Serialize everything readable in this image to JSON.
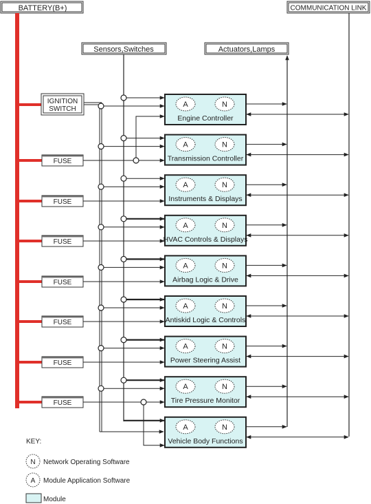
{
  "colors": {
    "battery_bus": "#e0302a",
    "module_fill": "#d8f3f3",
    "line": "#222222"
  },
  "headers": {
    "battery": "BATTERY(B+)",
    "communication_link": "COMMUNICATION LINK",
    "sensors_switches": "Sensors,Switches",
    "actuators_lamps": "Actuators,Lamps"
  },
  "power": {
    "ignition_switch_line1": "IGNITION",
    "ignition_switch_line2": "SWITCH",
    "fuse_label": "FUSE",
    "fuses": [
      "FUSE",
      "FUSE",
      "FUSE",
      "FUSE",
      "FUSE",
      "FUSE",
      "FUSE"
    ]
  },
  "module_badges": {
    "application": "A",
    "network": "N"
  },
  "modules": [
    {
      "name": "Engine Controller"
    },
    {
      "name": "Transmission Controller"
    },
    {
      "name": "Instruments & Displays"
    },
    {
      "name": "HVAC Controls & Displays"
    },
    {
      "name": "Airbag Logic & Drive"
    },
    {
      "name": "Antiskid Logic & Controls"
    },
    {
      "name": "Power Steering Assist"
    },
    {
      "name": "Tire Pressure Monitor"
    },
    {
      "name": "Vehicle Body Functions"
    }
  ],
  "key": {
    "title": "KEY:",
    "items": [
      {
        "symbol": "N",
        "label": "Network Operating Software"
      },
      {
        "symbol": "A",
        "label": "Module Application Software"
      },
      {
        "symbol": "",
        "label": "Module"
      }
    ]
  }
}
